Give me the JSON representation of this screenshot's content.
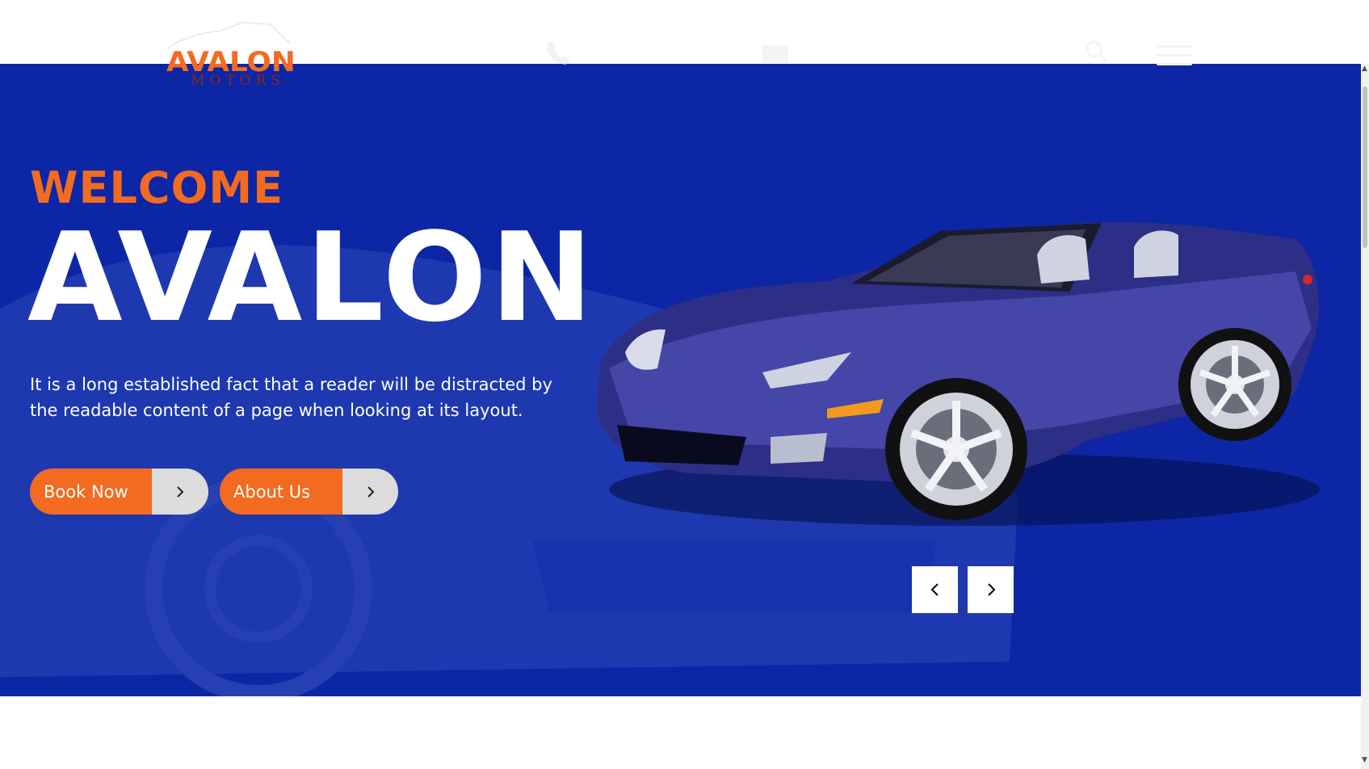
{
  "logo": {
    "brand": "AVALON",
    "sub": "MOTORS"
  },
  "hero": {
    "welcome": "WELCOME",
    "headline": "AVALON",
    "description": "It is a long established fact that a reader will be distracted by the readable content of a page when looking at its layout.",
    "buttons": [
      {
        "label": "Book Now",
        "icon": "chevron-right-icon"
      },
      {
        "label": "About Us",
        "icon": "chevron-right-icon"
      }
    ],
    "slider": {
      "prev_icon": "chevron-left-icon",
      "next_icon": "chevron-right-icon"
    }
  },
  "header": {
    "icons": [
      "phone-icon",
      "mail-icon",
      "search-icon",
      "menu-icon"
    ]
  },
  "colors": {
    "hero_bg": "#0c26a6",
    "accent": "#f26b21",
    "button_arrow_bg": "#dcdcdc",
    "white": "#ffffff"
  }
}
